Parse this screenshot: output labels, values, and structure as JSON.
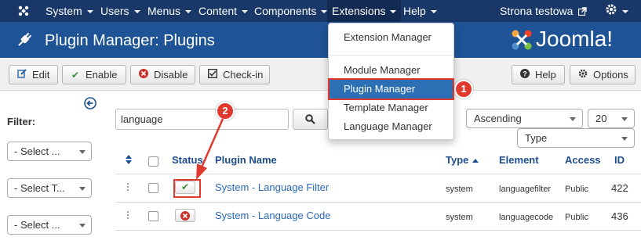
{
  "navbar": {
    "menu": [
      {
        "label": "System"
      },
      {
        "label": "Users"
      },
      {
        "label": "Menus"
      },
      {
        "label": "Content"
      },
      {
        "label": "Components"
      },
      {
        "label": "Extensions"
      },
      {
        "label": "Help"
      }
    ],
    "site_link": "Strona testowa"
  },
  "extensions_menu": {
    "items": [
      {
        "label": "Extension Manager"
      },
      {
        "label": "Module Manager"
      },
      {
        "label": "Plugin Manager"
      },
      {
        "label": "Template Manager"
      },
      {
        "label": "Language Manager"
      }
    ]
  },
  "header": {
    "title": "Plugin Manager: Plugins",
    "logo_text": "Joomla!"
  },
  "toolbar": {
    "edit": "Edit",
    "enable": "Enable",
    "disable": "Disable",
    "checkin": "Check-in",
    "help": "Help",
    "options": "Options"
  },
  "sidebar": {
    "filter_label": "Filter:",
    "selects": [
      "- Select ...",
      "- Select T...",
      "- Select ..."
    ]
  },
  "search": {
    "value": "language"
  },
  "list_controls": {
    "sort_direction": "Ascending",
    "limit": "20",
    "sort_field": "Type"
  },
  "table": {
    "headers": {
      "status": "Status",
      "name": "Plugin Name",
      "type": "Type",
      "element": "Element",
      "access": "Access",
      "id": "ID"
    },
    "rows": [
      {
        "name": "System - Language Filter",
        "type": "system",
        "element": "languagefilter",
        "access": "Public",
        "id": "422",
        "enabled": true
      },
      {
        "name": "System - Language Code",
        "type": "system",
        "element": "languagecode",
        "access": "Public",
        "id": "436",
        "enabled": false
      }
    ]
  },
  "annotations": {
    "badge_1": "1",
    "badge_2": "2"
  },
  "colors": {
    "navbar": "#1a3867",
    "header": "#1e5496",
    "highlight": "#2d6fb5",
    "annotation": "#e03a2f",
    "link": "#2a69b8"
  }
}
